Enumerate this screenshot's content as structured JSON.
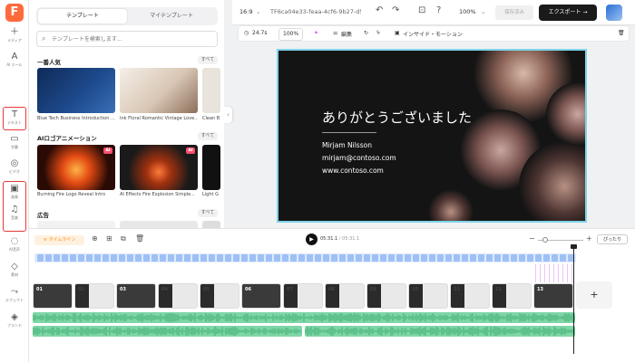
{
  "nav": {
    "items": [
      {
        "name": "media",
        "label": "メディア",
        "icon": "＋"
      },
      {
        "name": "ai",
        "label": "AI ツール",
        "icon": "A"
      },
      {
        "name": "text",
        "label": "テキスト",
        "icon": "T"
      },
      {
        "name": "caption",
        "label": "字幕",
        "icon": "▭"
      },
      {
        "name": "video",
        "label": "ビデオ",
        "icon": "◎"
      },
      {
        "name": "image",
        "label": "画像",
        "icon": "▣"
      },
      {
        "name": "music",
        "label": "音楽",
        "icon": "♫"
      },
      {
        "name": "ai-voice",
        "label": "AI音声",
        "icon": "◌"
      },
      {
        "name": "elements",
        "label": "素材",
        "icon": "◇"
      },
      {
        "name": "transition",
        "label": "エフェクト",
        "icon": "⤳"
      },
      {
        "name": "brand",
        "label": "ブランド",
        "icon": "◈"
      }
    ]
  },
  "panel": {
    "tabs": [
      "テンプレート",
      "マイテンプレート"
    ],
    "search_placeholder": "テンプレートを検索します...",
    "see_all": "すべて",
    "sections": [
      {
        "title": "一番人気",
        "items": [
          "Blue Tech Business Introduction ...",
          "Ink Floral Romantic Vintage Love...",
          "Clean B"
        ]
      },
      {
        "title": "AIロゴアニメーション",
        "items": [
          "Burning Fire Logo Reveal Intro",
          "AI Effects Fire Explosion Simple...",
          "Light G"
        ]
      },
      {
        "title": "広告",
        "items": []
      }
    ],
    "ai_badge": "AI"
  },
  "topbar": {
    "aspect": "16:9",
    "project_name": "TF6ca04e33-feaa-4cf6-9b27-d5...",
    "zoom": "100%",
    "save": "保存済み",
    "export": "エクスポート"
  },
  "edit_toolbar": {
    "duration": "24.7s",
    "scale": "100%",
    "edit": "編集",
    "inside_motion": "インサイド・モーション"
  },
  "slide": {
    "title": "ありがとうございました",
    "name": "Mirjam Nilsson",
    "email": "mirjam@contoso.com",
    "web": "www.contoso.com"
  },
  "timeline": {
    "label": "タイムライン",
    "current": "05:31.1",
    "total": "/ 05:31.1",
    "fit": "ぴったり",
    "clips": [
      {
        "num": "01",
        "style": "dark"
      },
      {
        "num": "02",
        "style": "light"
      },
      {
        "num": "03",
        "style": "dark"
      },
      {
        "num": "04",
        "style": "light"
      },
      {
        "num": "05",
        "style": "light"
      },
      {
        "num": "06",
        "style": "dark"
      },
      {
        "num": "07",
        "style": "light"
      },
      {
        "num": "08",
        "style": "light"
      },
      {
        "num": "09",
        "style": "light"
      },
      {
        "num": "10",
        "style": "light"
      },
      {
        "num": "11",
        "style": "light"
      },
      {
        "num": "12",
        "style": "light"
      },
      {
        "num": "13",
        "style": "dark"
      }
    ],
    "add": "+"
  },
  "colors": {
    "brand": "#ff6a3d",
    "canvas_border": "#7fd3e8",
    "audio": "#7fd6a7",
    "caption": "#dfe9fb",
    "highlight": "#e53935"
  }
}
